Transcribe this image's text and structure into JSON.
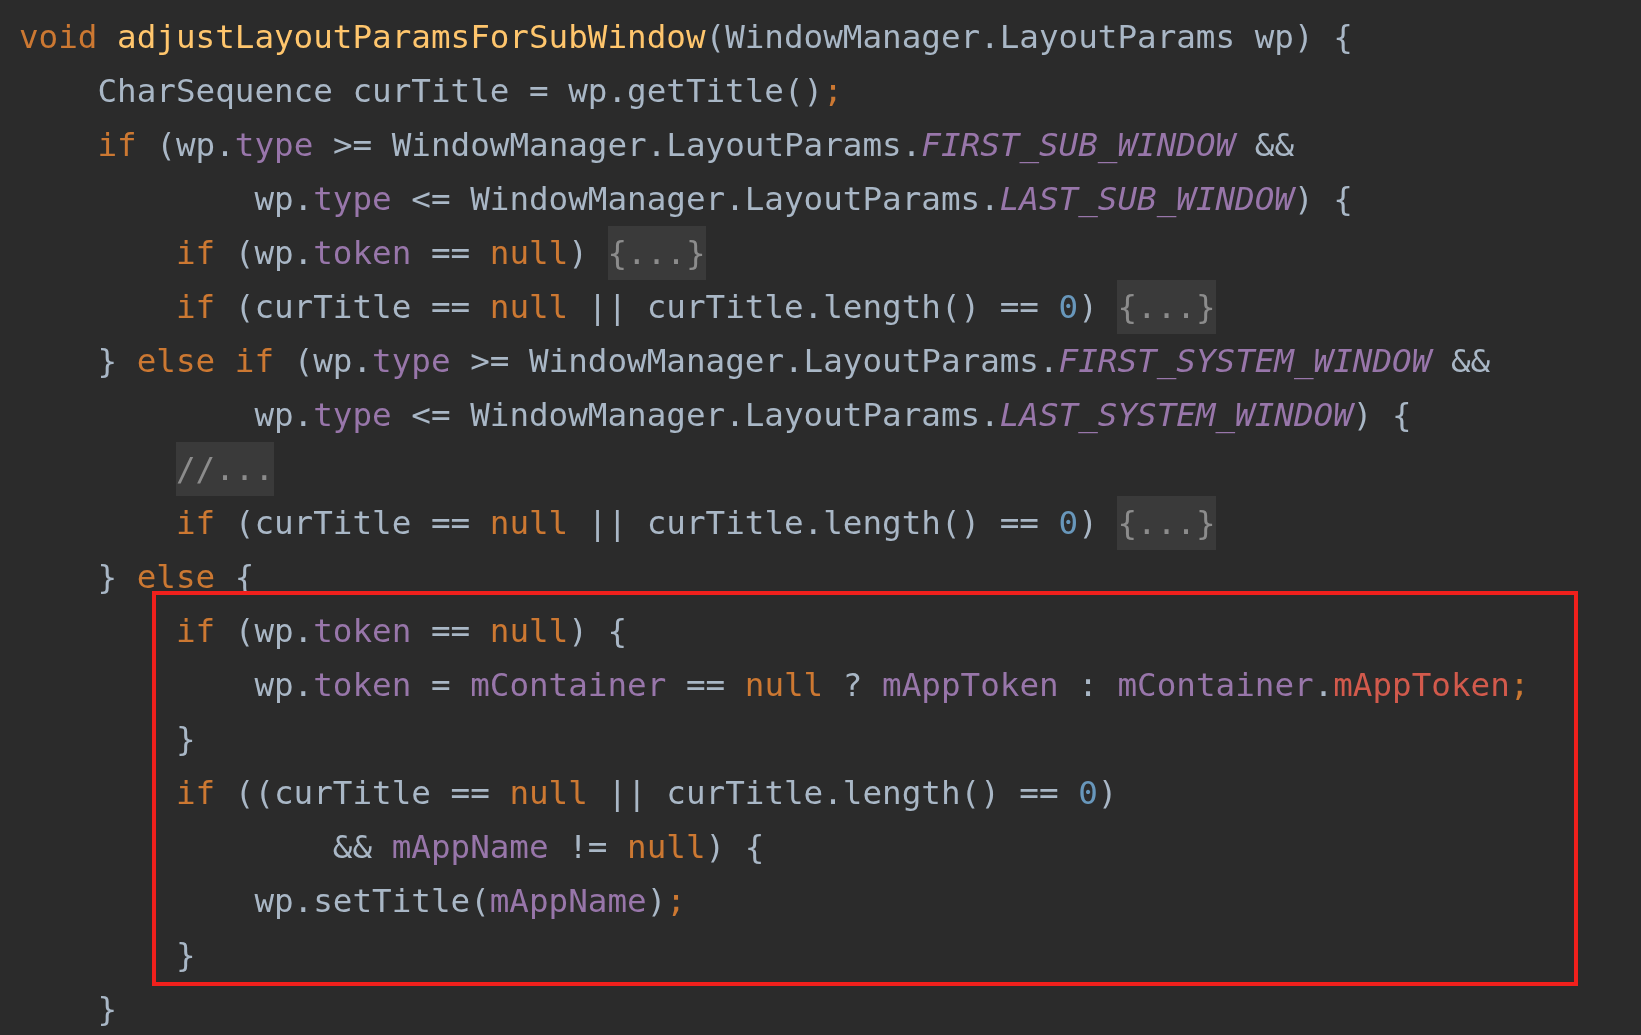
{
  "blocks": [
    {
      "boxed": false,
      "lines": [
        {
          "tokens": [
            {
              "kind": "kw",
              "text": "void"
            },
            {
              "kind": "fn",
              "text": " adjustLayoutParamsForSubWindow"
            },
            {
              "kind": "plain",
              "text": "(WindowManager.LayoutParams wp) {"
            }
          ]
        },
        {
          "tokens": [
            {
              "kind": "plain",
              "text": "    CharSequence curTitle = wp.getTitle()"
            },
            {
              "kind": "kw",
              "text": ";"
            }
          ]
        },
        {
          "tokens": [
            {
              "kind": "kw",
              "text": "    if"
            },
            {
              "kind": "plain",
              "text": " (wp."
            },
            {
              "kind": "field",
              "text": "type"
            },
            {
              "kind": "plain",
              "text": " >= WindowManager.LayoutParams."
            },
            {
              "kind": "const",
              "text": "FIRST_SUB_WINDOW"
            },
            {
              "kind": "plain",
              "text": " &&"
            }
          ]
        },
        {
          "tokens": [
            {
              "kind": "plain",
              "text": "            wp."
            },
            {
              "kind": "field",
              "text": "type"
            },
            {
              "kind": "plain",
              "text": " <= WindowManager.LayoutParams."
            },
            {
              "kind": "const",
              "text": "LAST_SUB_WINDOW"
            },
            {
              "kind": "plain",
              "text": ") {"
            }
          ]
        },
        {
          "tokens": [
            {
              "kind": "kw",
              "text": "        if"
            },
            {
              "kind": "plain",
              "text": " (wp."
            },
            {
              "kind": "field",
              "text": "token"
            },
            {
              "kind": "plain",
              "text": " == "
            },
            {
              "kind": "kw",
              "text": "null"
            },
            {
              "kind": "plain",
              "text": ") "
            },
            {
              "kind": "fold",
              "text": "{...}"
            }
          ]
        },
        {
          "tokens": [
            {
              "kind": "kw",
              "text": "        if"
            },
            {
              "kind": "plain",
              "text": " (curTitle == "
            },
            {
              "kind": "kw",
              "text": "null"
            },
            {
              "kind": "plain",
              "text": " || curTitle.length() == "
            },
            {
              "kind": "num",
              "text": "0"
            },
            {
              "kind": "plain",
              "text": ") "
            },
            {
              "kind": "fold",
              "text": "{...}"
            }
          ]
        },
        {
          "tokens": [
            {
              "kind": "plain",
              "text": "    } "
            },
            {
              "kind": "kw",
              "text": "else if"
            },
            {
              "kind": "plain",
              "text": " (wp."
            },
            {
              "kind": "field",
              "text": "type"
            },
            {
              "kind": "plain",
              "text": " >= WindowManager.LayoutParams."
            },
            {
              "kind": "const",
              "text": "FIRST_SYSTEM_WINDOW"
            },
            {
              "kind": "plain",
              "text": " &&"
            }
          ]
        },
        {
          "tokens": [
            {
              "kind": "plain",
              "text": "            wp."
            },
            {
              "kind": "field",
              "text": "type"
            },
            {
              "kind": "plain",
              "text": " <= WindowManager.LayoutParams."
            },
            {
              "kind": "const",
              "text": "LAST_SYSTEM_WINDOW"
            },
            {
              "kind": "plain",
              "text": ") {"
            }
          ]
        },
        {
          "tokens": [
            {
              "kind": "fold",
              "text": "        //..."
            }
          ]
        },
        {
          "tokens": [
            {
              "kind": "kw",
              "text": "        if"
            },
            {
              "kind": "plain",
              "text": " (curTitle == "
            },
            {
              "kind": "kw",
              "text": "null"
            },
            {
              "kind": "plain",
              "text": " || curTitle.length() == "
            },
            {
              "kind": "num",
              "text": "0"
            },
            {
              "kind": "plain",
              "text": ") "
            },
            {
              "kind": "fold",
              "text": "{...}"
            }
          ]
        },
        {
          "tokens": [
            {
              "kind": "plain",
              "text": "    } "
            },
            {
              "kind": "kw",
              "text": "else"
            },
            {
              "kind": "plain",
              "text": " {"
            }
          ]
        }
      ]
    },
    {
      "boxed": true,
      "lines": [
        {
          "tokens": [
            {
              "kind": "kw",
              "text": "        if"
            },
            {
              "kind": "plain",
              "text": " (wp."
            },
            {
              "kind": "field",
              "text": "token"
            },
            {
              "kind": "plain",
              "text": " == "
            },
            {
              "kind": "kw",
              "text": "null"
            },
            {
              "kind": "plain",
              "text": ") {"
            }
          ]
        },
        {
          "tokens": [
            {
              "kind": "plain",
              "text": "            wp."
            },
            {
              "kind": "field",
              "text": "token"
            },
            {
              "kind": "plain",
              "text": " = "
            },
            {
              "kind": "field",
              "text": "mContainer"
            },
            {
              "kind": "plain",
              "text": " == "
            },
            {
              "kind": "kw",
              "text": "null"
            },
            {
              "kind": "plain",
              "text": " ? "
            },
            {
              "kind": "field",
              "text": "mAppToken"
            },
            {
              "kind": "plain",
              "text": " : "
            },
            {
              "kind": "field",
              "text": "mContainer"
            },
            {
              "kind": "plain",
              "text": "."
            },
            {
              "kind": "red",
              "text": "mAppToken"
            },
            {
              "kind": "kw",
              "text": ";"
            }
          ]
        },
        {
          "tokens": [
            {
              "kind": "plain",
              "text": "        }"
            }
          ]
        },
        {
          "tokens": [
            {
              "kind": "kw",
              "text": "        if"
            },
            {
              "kind": "plain",
              "text": " ((curTitle == "
            },
            {
              "kind": "kw",
              "text": "null"
            },
            {
              "kind": "plain",
              "text": " || curTitle.length() == "
            },
            {
              "kind": "num",
              "text": "0"
            },
            {
              "kind": "plain",
              "text": ")"
            }
          ]
        },
        {
          "tokens": [
            {
              "kind": "plain",
              "text": "                && "
            },
            {
              "kind": "field",
              "text": "mAppName"
            },
            {
              "kind": "plain",
              "text": " != "
            },
            {
              "kind": "kw",
              "text": "null"
            },
            {
              "kind": "plain",
              "text": ") {"
            }
          ]
        },
        {
          "tokens": [
            {
              "kind": "plain",
              "text": "            wp.setTitle("
            },
            {
              "kind": "field",
              "text": "mAppName"
            },
            {
              "kind": "plain",
              "text": ")"
            },
            {
              "kind": "kw",
              "text": ";"
            }
          ]
        },
        {
          "tokens": [
            {
              "kind": "plain",
              "text": "        }"
            }
          ]
        }
      ]
    },
    {
      "boxed": false,
      "lines": [
        {
          "tokens": [
            {
              "kind": "plain",
              "text": "    }"
            }
          ]
        }
      ]
    }
  ]
}
